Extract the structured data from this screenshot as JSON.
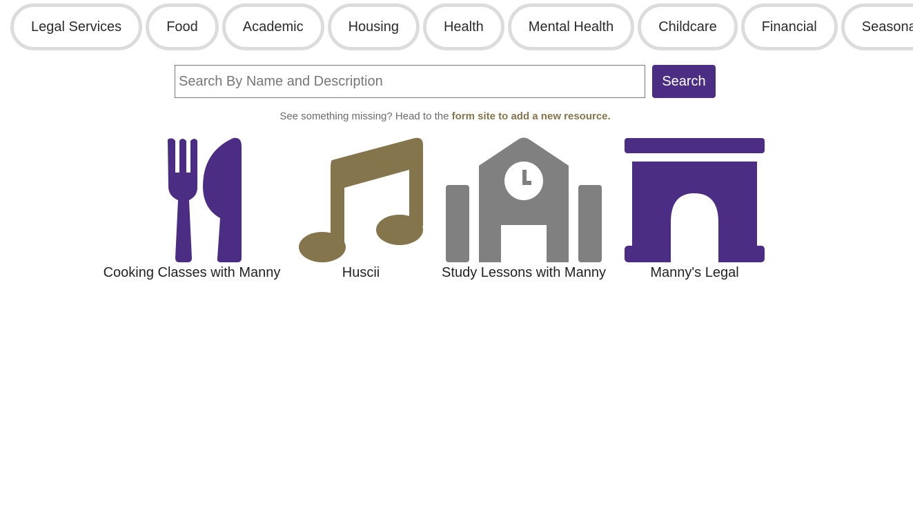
{
  "filters": [
    {
      "label": "Legal Services"
    },
    {
      "label": "Food"
    },
    {
      "label": "Academic"
    },
    {
      "label": "Housing"
    },
    {
      "label": "Health"
    },
    {
      "label": "Mental Health"
    },
    {
      "label": "Childcare"
    },
    {
      "label": "Financial"
    },
    {
      "label": "Seasonal"
    }
  ],
  "search": {
    "placeholder": "Search By Name and Description",
    "value": "",
    "button_label": "Search"
  },
  "missing_note": {
    "prefix": "See something missing? Head to the ",
    "link_text": "form site to add a new resource."
  },
  "resources": [
    {
      "name": "Cooking Classes with Manny",
      "icon": "utensils-icon",
      "color": "#4b2e83"
    },
    {
      "name": "Huscii",
      "icon": "music-note-icon",
      "color": "#85754d"
    },
    {
      "name": "Study Lessons with Manny",
      "icon": "school-icon",
      "color": "#808080"
    },
    {
      "name": "Manny's Legal",
      "icon": "archway-icon",
      "color": "#4b2e83"
    }
  ],
  "colors": {
    "purple": "#4b2e83",
    "gold": "#85754d",
    "gray": "#808080",
    "pill_border": "#dcdcdc"
  }
}
